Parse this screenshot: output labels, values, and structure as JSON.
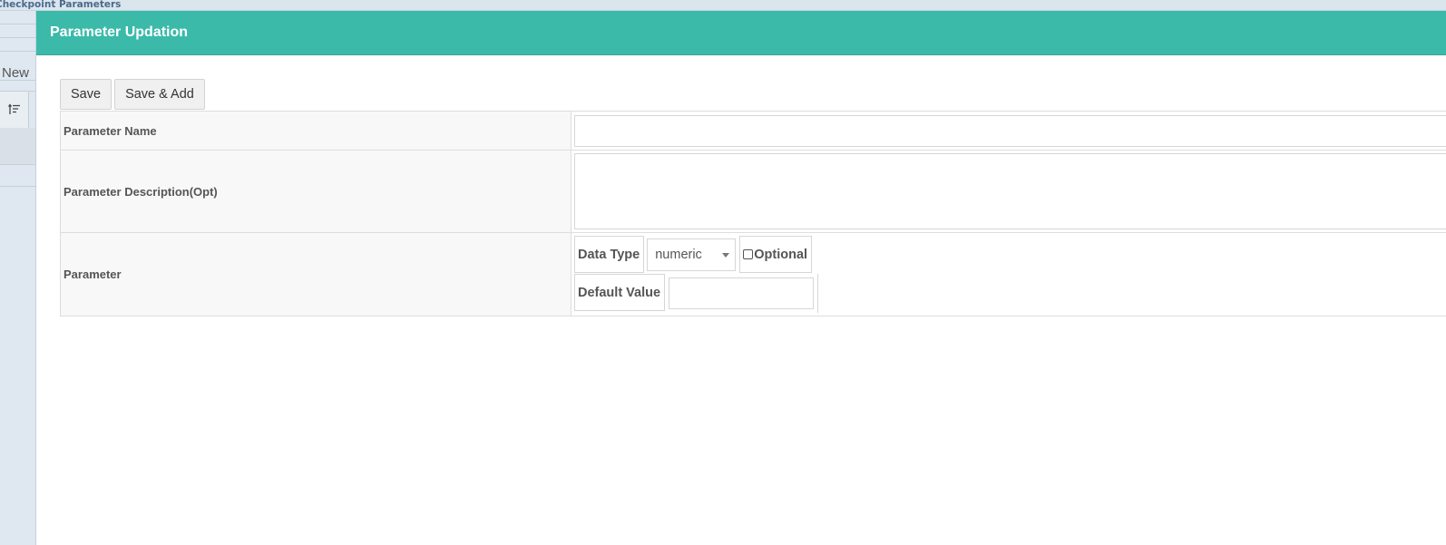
{
  "background": {
    "breadcrumb": "Checkpoint Parameters",
    "new_label": "New",
    "sort_icon": "sort-ascending-icon"
  },
  "modal": {
    "title": "Parameter Updation",
    "header_color": "#3bbaa9",
    "toolbar": {
      "save_label": "Save",
      "save_add_label": "Save & Add"
    },
    "form": {
      "name_label": "Parameter Name",
      "name_value": "",
      "description_label": "Parameter Description(Opt)",
      "description_value": "",
      "parameter_label": "Parameter",
      "data_type_label": "Data Type",
      "data_type_value": "numeric",
      "optional_label": "Optional",
      "optional_checked": false,
      "default_value_label": "Default Value",
      "default_value": ""
    }
  }
}
